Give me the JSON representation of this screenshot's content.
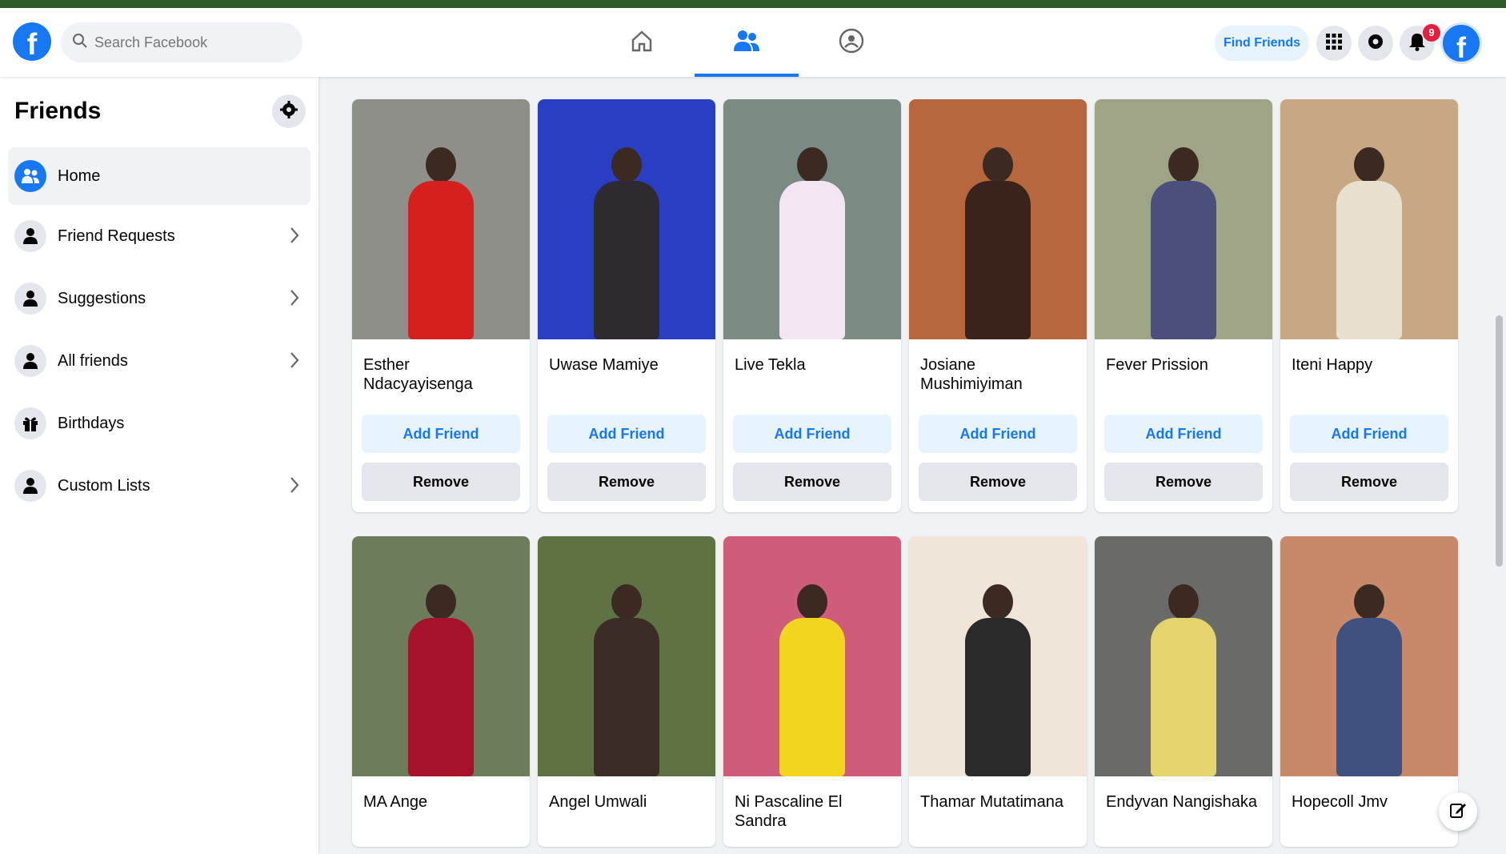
{
  "header": {
    "logo_letter": "f",
    "search_placeholder": "Search Facebook",
    "find_friends_label": "Find Friends",
    "notification_count": "9",
    "nav_tabs": [
      {
        "icon": "home-icon",
        "active": false
      },
      {
        "icon": "friends-icon",
        "active": true
      },
      {
        "icon": "groups-icon",
        "active": false
      }
    ]
  },
  "sidebar": {
    "title": "Friends",
    "items": [
      {
        "label": "Home",
        "icon": "friends-icon",
        "active": true,
        "chevron": false
      },
      {
        "label": "Friend Requests",
        "icon": "friend-request-icon",
        "active": false,
        "chevron": true
      },
      {
        "label": "Suggestions",
        "icon": "suggestion-icon",
        "active": false,
        "chevron": true
      },
      {
        "label": "All friends",
        "icon": "all-friends-icon",
        "active": false,
        "chevron": true
      },
      {
        "label": "Birthdays",
        "icon": "gift-icon",
        "active": false,
        "chevron": false
      },
      {
        "label": "Custom Lists",
        "icon": "custom-list-icon",
        "active": false,
        "chevron": true
      }
    ]
  },
  "cards": {
    "add_label": "Add Friend",
    "remove_label": "Remove",
    "row1": [
      {
        "name": "Esther Ndacyayisenga",
        "bg": "#8d8f88",
        "clothes": "#d61f1f"
      },
      {
        "name": "Uwase Mamiye",
        "bg": "#2a3ec4",
        "clothes": "#2e2a2f"
      },
      {
        "name": "Live Tekla",
        "bg": "#7b8a82",
        "clothes": "#f1e6f2"
      },
      {
        "name": "Josiane Mushimiyiman",
        "bg": "#b7673d",
        "clothes": "#3a231b"
      },
      {
        "name": "Fever Prission",
        "bg": "#9fa487",
        "clothes": "#4a4f7e"
      },
      {
        "name": "Iteni Happy",
        "bg": "#c7a882",
        "clothes": "#e8e0cf"
      }
    ],
    "row2": [
      {
        "name": "MA Ange",
        "bg": "#6d7d5c",
        "clothes": "#a5122a"
      },
      {
        "name": "Angel Umwali",
        "bg": "#5f7244",
        "clothes": "#3b2c25"
      },
      {
        "name": "Ni Pascaline El Sandra",
        "bg": "#d05c7c",
        "clothes": "#f2d51f"
      },
      {
        "name": "Thamar Mutatimana",
        "bg": "#efe6d9",
        "clothes": "#2b2a2a"
      },
      {
        "name": "Endyvan Nangishaka",
        "bg": "#6a6a66",
        "clothes": "#e4d470"
      },
      {
        "name": "Hopecoll Jmv",
        "bg": "#c8896a",
        "clothes": "#3f517f"
      }
    ]
  },
  "colors": {
    "accent": "#1877f2",
    "badge": "#e41e3f",
    "button_light": "#e7f3ff",
    "button_gray": "#e4e6eb"
  }
}
